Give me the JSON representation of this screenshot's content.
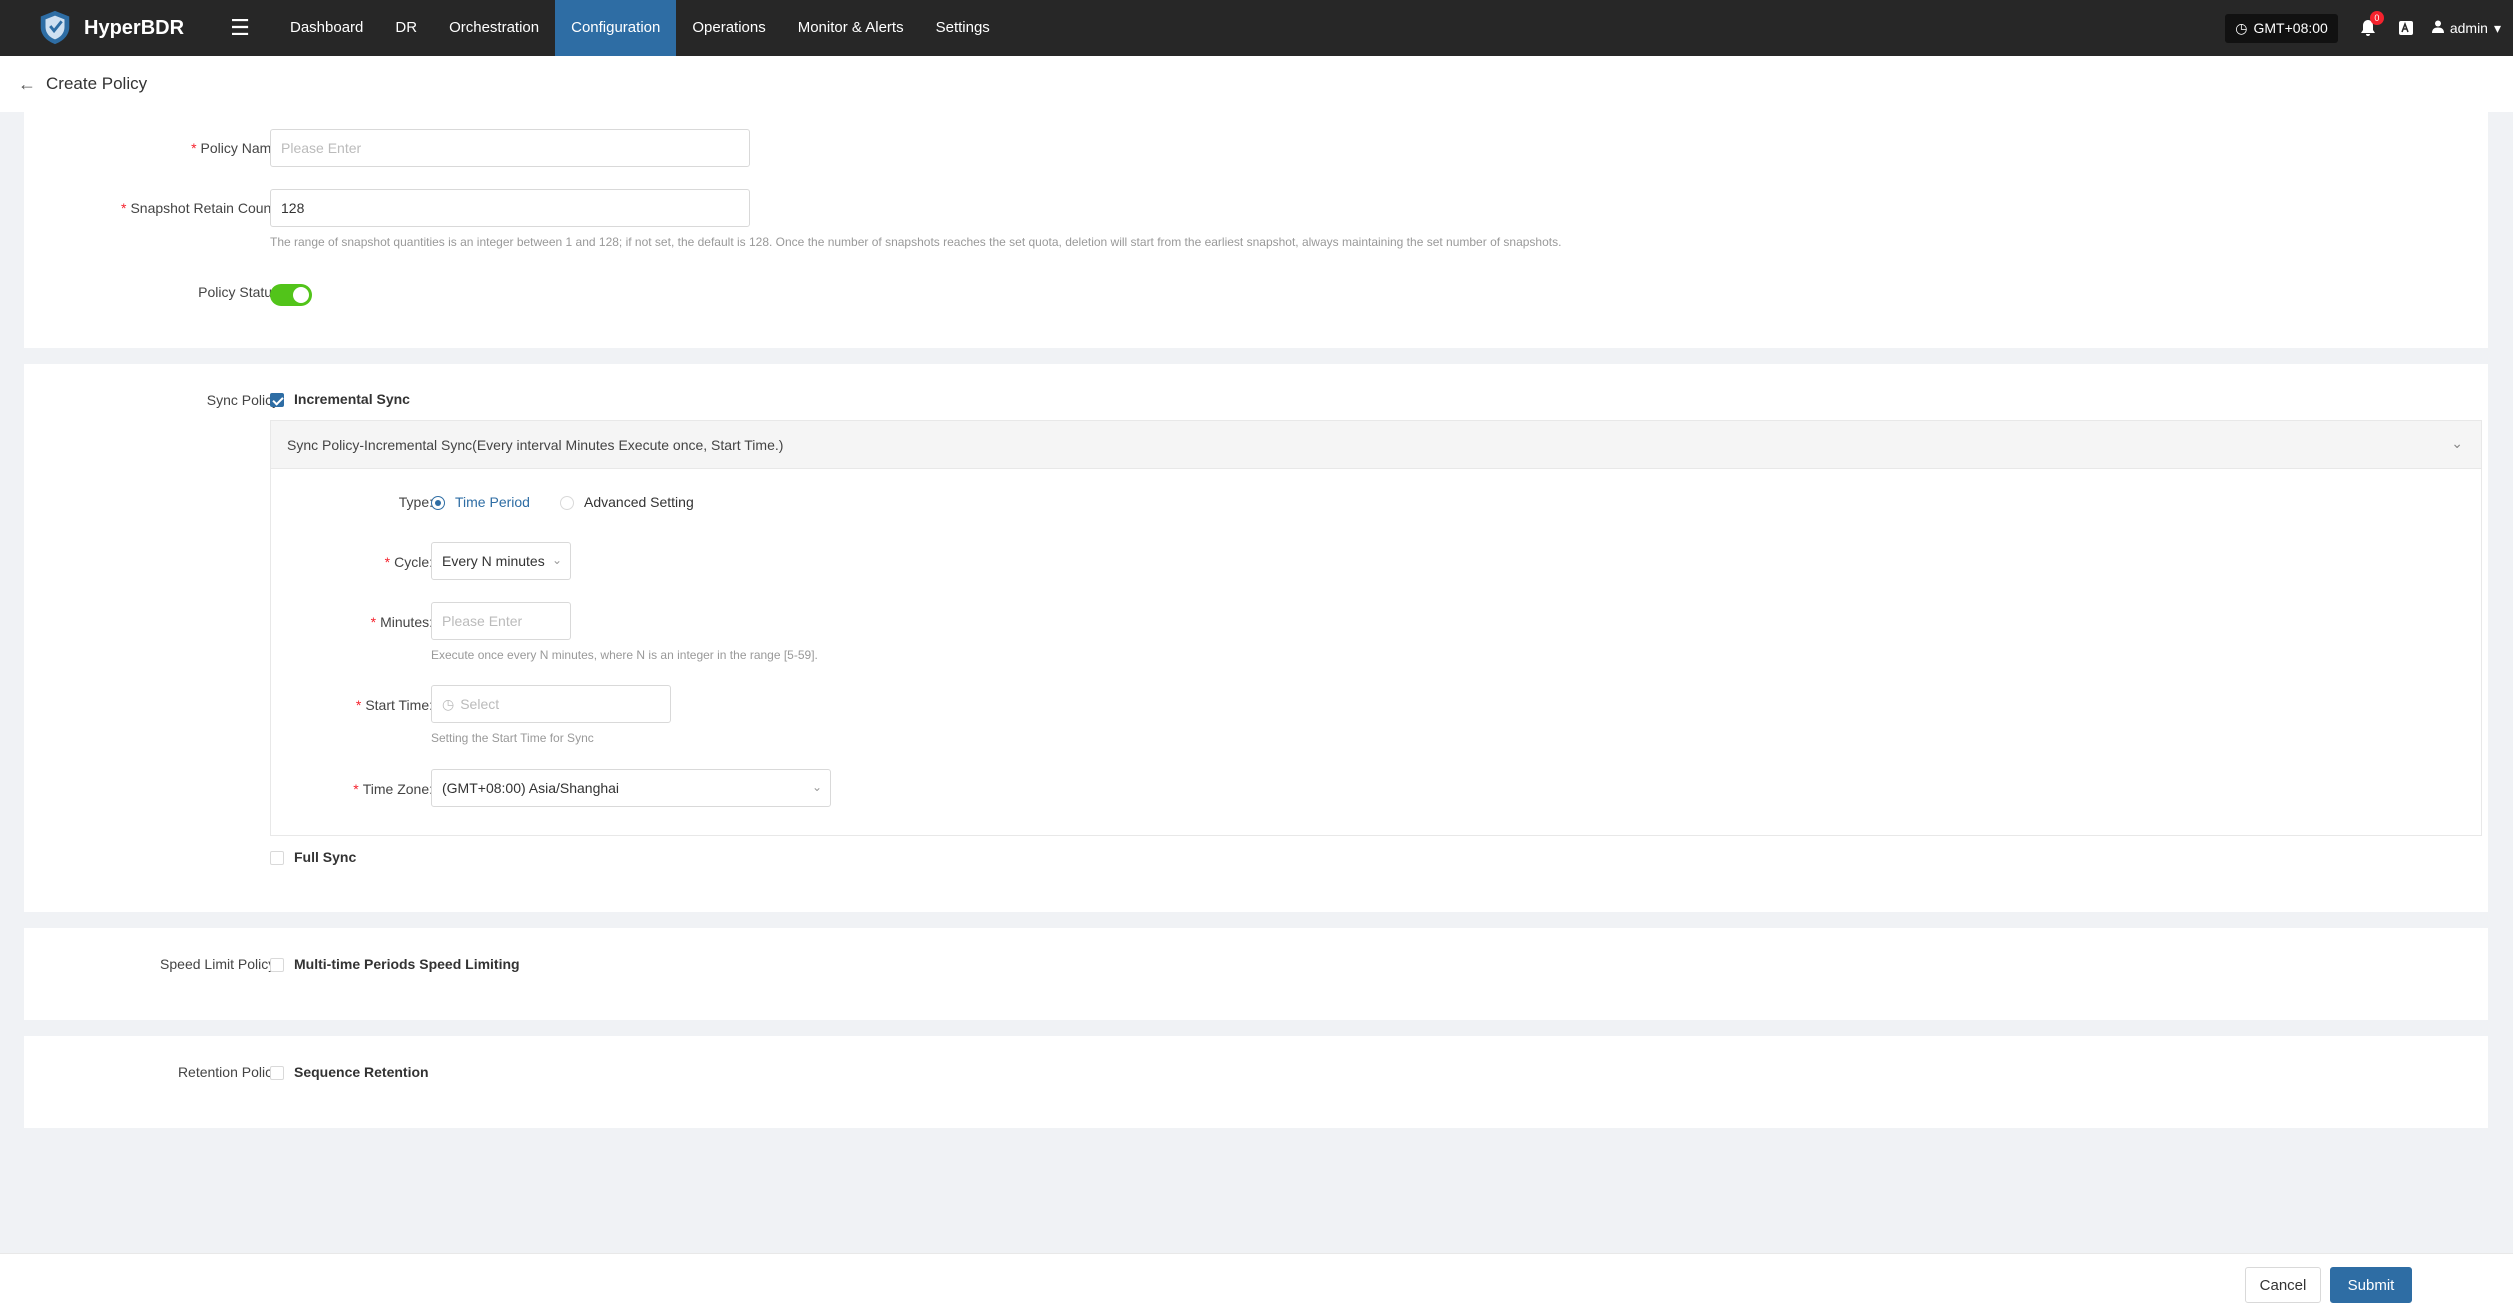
{
  "header": {
    "brand": "HyperBDR",
    "nav": [
      {
        "label": "Dashboard",
        "active": false
      },
      {
        "label": "DR",
        "active": false
      },
      {
        "label": "Orchestration",
        "active": false
      },
      {
        "label": "Configuration",
        "active": true
      },
      {
        "label": "Operations",
        "active": false
      },
      {
        "label": "Monitor & Alerts",
        "active": false
      },
      {
        "label": "Settings",
        "active": false
      }
    ],
    "timezone": "GMT+08:00",
    "notification_count": "0",
    "user": "admin"
  },
  "page": {
    "title": "Create Policy"
  },
  "basic": {
    "policy_name_label": "Policy Name:",
    "policy_name_placeholder": "Please Enter",
    "snapshot_label": "Snapshot Retain Count :",
    "snapshot_value": "128",
    "snapshot_hint": "The range of snapshot quantities is an integer between 1 and 128; if not set, the default is 128. Once the number of snapshots reaches the set quota, deletion will start from the earliest snapshot, always maintaining the set number of snapshots.",
    "status_label": "Policy Status:",
    "status_on": true
  },
  "sync": {
    "label": "Sync Policy:",
    "incremental_label": "Incremental Sync",
    "incremental_checked": true,
    "panel_title": "Sync Policy-Incremental Sync(Every interval Minutes Execute once, Start Time.)",
    "type_label": "Type:",
    "type_time_period": "Time Period",
    "type_advanced": "Advanced Setting",
    "cycle_label": "Cycle:",
    "cycle_value": "Every N minutes",
    "minutes_label": "Minutes:",
    "minutes_placeholder": "Please Enter",
    "minutes_hint": "Execute once every N minutes, where N is an integer in the range [5-59].",
    "start_label": "Start Time:",
    "start_placeholder": "Select",
    "start_hint": "Setting the Start Time for Sync",
    "tz_label": "Time Zone:",
    "tz_value": "(GMT+08:00) Asia/Shanghai",
    "full_label": "Full Sync",
    "full_checked": false
  },
  "speed": {
    "label": "Speed Limit Policy :",
    "option": "Multi-time Periods Speed Limiting"
  },
  "retention": {
    "label": "Retention Policy:",
    "option": "Sequence Retention"
  },
  "footer": {
    "cancel": "Cancel",
    "submit": "Submit"
  }
}
